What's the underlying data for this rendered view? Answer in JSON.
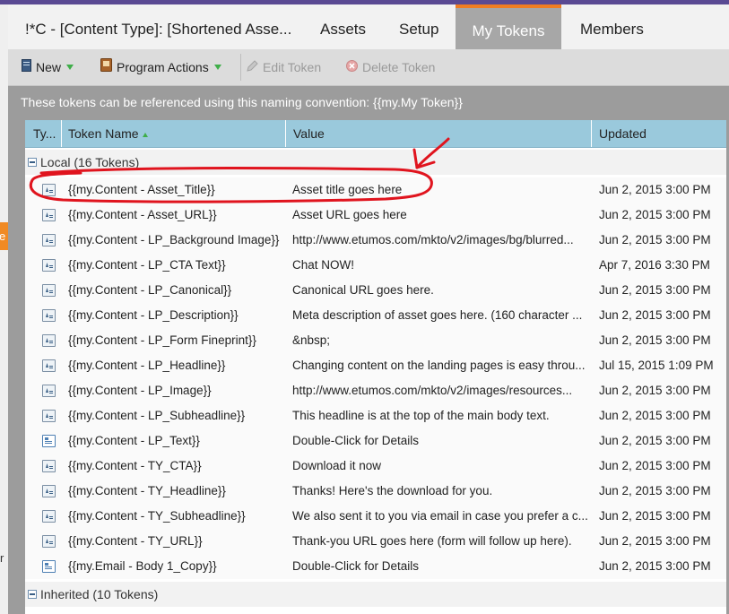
{
  "colors": {
    "accent_orange": "#ef7d22",
    "header_purple": "#5a4a93",
    "column_header_blue": "#9ac9dc",
    "annotation_red": "#e0141e",
    "green": "#3fae49"
  },
  "left_gutter": {
    "tab_text": "e",
    "text": "r"
  },
  "tabs": [
    {
      "label": "!*C - [Content Type]: [Shortened Asse...",
      "active": false
    },
    {
      "label": "Assets",
      "active": false
    },
    {
      "label": "Setup",
      "active": false
    },
    {
      "label": "My Tokens",
      "active": true
    },
    {
      "label": "Members",
      "active": false
    }
  ],
  "toolbar": {
    "new_label": "New",
    "new_icon": "document-icon",
    "program_actions_label": "Program Actions",
    "program_actions_icon": "program-icon",
    "edit_token_label": "Edit Token",
    "edit_icon": "pencil-icon",
    "delete_token_label": "Delete Token",
    "delete_icon": "delete-icon"
  },
  "info_text": "These tokens can be referenced using this naming convention: {{my.My Token}}",
  "grid": {
    "columns": {
      "type": "Ty...",
      "token_name": "Token Name",
      "value": "Value",
      "updated": "Updated"
    },
    "groups": {
      "local": "Local (16 Tokens)",
      "inherited": "Inherited (10 Tokens)"
    },
    "rows": [
      {
        "icon": "text-token-icon",
        "name": "{{my.Content - Asset_Title}}",
        "value": "Asset title goes here",
        "updated": "Jun 2, 2015 3:00 PM"
      },
      {
        "icon": "text-token-icon",
        "name": "{{my.Content - Asset_URL}}",
        "value": "Asset URL goes here",
        "updated": "Jun 2, 2015 3:00 PM"
      },
      {
        "icon": "text-token-icon",
        "name": "{{my.Content - LP_Background Image}}",
        "value": "http://www.etumos.com/mkto/v2/images/bg/blurred...",
        "updated": "Jun 2, 2015 3:00 PM"
      },
      {
        "icon": "text-token-icon",
        "name": "{{my.Content - LP_CTA Text}}",
        "value": "Chat NOW!",
        "updated": "Apr 7, 2016 3:30 PM"
      },
      {
        "icon": "text-token-icon",
        "name": "{{my.Content - LP_Canonical}}",
        "value": "Canonical URL goes here.",
        "updated": "Jun 2, 2015 3:00 PM"
      },
      {
        "icon": "text-token-icon",
        "name": "{{my.Content - LP_Description}}",
        "value": "Meta description of asset goes here. (160 character ...",
        "updated": "Jun 2, 2015 3:00 PM"
      },
      {
        "icon": "text-token-icon",
        "name": "{{my.Content - LP_Form Fineprint}}",
        "value": "&nbsp;",
        "updated": "Jun 2, 2015 3:00 PM"
      },
      {
        "icon": "text-token-icon",
        "name": "{{my.Content - LP_Headline}}",
        "value": "Changing content on the landing pages is easy throu...",
        "updated": "Jul 15, 2015 1:09 PM"
      },
      {
        "icon": "text-token-icon",
        "name": "{{my.Content - LP_Image}}",
        "value": "http://www.etumos.com/mkto/v2/images/resources...",
        "updated": "Jun 2, 2015 3:00 PM"
      },
      {
        "icon": "text-token-icon",
        "name": "{{my.Content - LP_Subheadline}}",
        "value": "This headline is at the top of the main body text.",
        "updated": "Jun 2, 2015 3:00 PM"
      },
      {
        "icon": "rich-text-token-icon",
        "name": "{{my.Content - LP_Text}}",
        "value": "Double-Click for Details",
        "updated": "Jun 2, 2015 3:00 PM"
      },
      {
        "icon": "text-token-icon",
        "name": "{{my.Content - TY_CTA}}",
        "value": "Download it now",
        "updated": "Jun 2, 2015 3:00 PM"
      },
      {
        "icon": "text-token-icon",
        "name": "{{my.Content - TY_Headline}}",
        "value": "Thanks! Here's the download for you.",
        "updated": "Jun 2, 2015 3:00 PM"
      },
      {
        "icon": "text-token-icon",
        "name": "{{my.Content - TY_Subheadline}}",
        "value": "We also sent it to you via email in case you prefer a c...",
        "updated": "Jun 2, 2015 3:00 PM"
      },
      {
        "icon": "text-token-icon",
        "name": "{{my.Content - TY_URL}}",
        "value": "Thank-you URL goes here (form will follow up here).",
        "updated": "Jun 2, 2015 3:00 PM"
      },
      {
        "icon": "rich-text-token-icon",
        "name": "{{my.Email - Body 1_Copy}}",
        "value": "Double-Click for Details",
        "updated": "Jun 2, 2015 3:00 PM"
      }
    ]
  }
}
